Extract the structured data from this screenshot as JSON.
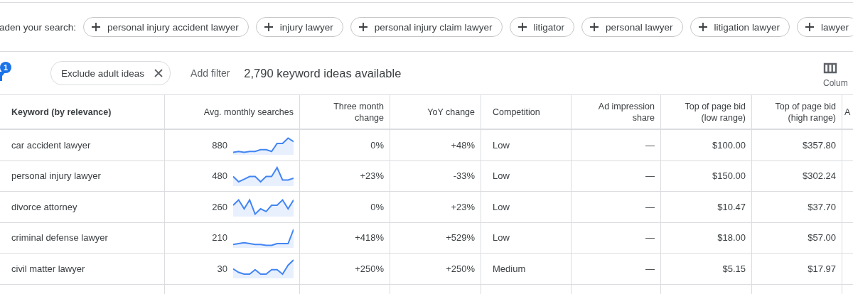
{
  "broaden": {
    "label": "aden your search:",
    "chips": [
      "personal injury accident lawyer",
      "injury lawyer",
      "personal injury claim lawyer",
      "litigator",
      "personal lawyer",
      "litigation lawyer",
      "lawyer"
    ]
  },
  "filter_bar": {
    "filter_count": "1",
    "active_filter": "Exclude adult ideas",
    "add_filter": "Add filter",
    "summary": "2,790 keyword ideas available",
    "columns_button": "Colum"
  },
  "table": {
    "columns": [
      "Keyword (by relevance)",
      "Avg. monthly searches",
      "Three month change",
      "YoY change",
      "Competition",
      "Ad impression share",
      "Top of page bid (low range)",
      "Top of page bid (high range)",
      "A"
    ],
    "rows": [
      [
        "car accident lawyer",
        "880",
        "0%",
        "+48%",
        "Low",
        "—",
        "$100.00",
        "$357.80"
      ],
      [
        "personal injury lawyer",
        "480",
        "+23%",
        "-33%",
        "Low",
        "—",
        "$150.00",
        "$302.24"
      ],
      [
        "divorce attorney",
        "260",
        "0%",
        "+23%",
        "Low",
        "—",
        "$10.47",
        "$37.70"
      ],
      [
        "criminal defense lawyer",
        "210",
        "+418%",
        "+529%",
        "Low",
        "—",
        "$18.00",
        "$57.00"
      ],
      [
        "civil matter lawyer",
        "30",
        "+250%",
        "+250%",
        "Medium",
        "—",
        "$5.15",
        "$17.97"
      ]
    ]
  }
}
